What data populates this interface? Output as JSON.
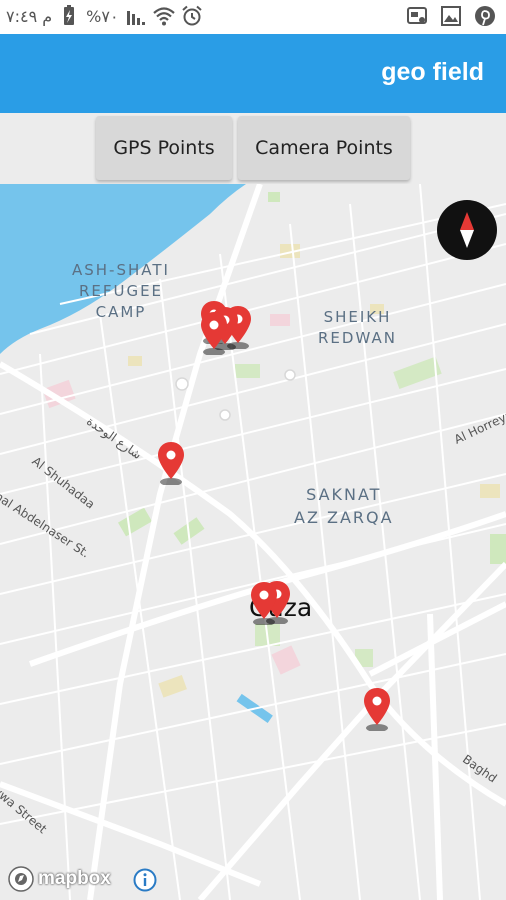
{
  "status_bar": {
    "time": "م ٧:٤٩",
    "battery": "%٧٠"
  },
  "app_bar": {
    "title": "geo field"
  },
  "buttons": {
    "gps_label": "GPS Points",
    "camera_label": "Camera Points"
  },
  "map": {
    "area_labels": {
      "shati_line1": "ASH-SHATI",
      "shati_line2": "REFUGEE",
      "shati_line3": "CAMP",
      "sheikh_line1": "SHEIKH",
      "sheikh_line2": "REDWAN",
      "saknat_line1": "SAKNAT",
      "saknat_line2": "AZ ZARQA"
    },
    "street_labels": {
      "wahda_ar": "شارع الوحدة",
      "al_shuhadaa": "Al Shuhadaa",
      "abdelnaser": "nal Abdelnaser St.",
      "al_horreya": "Al Horreya",
      "baghdad": "Baghd",
      "street_bottom": "ywa Street"
    },
    "city_label": "Gaza",
    "attribution": "mapbox",
    "marker_color": "#e53935"
  }
}
